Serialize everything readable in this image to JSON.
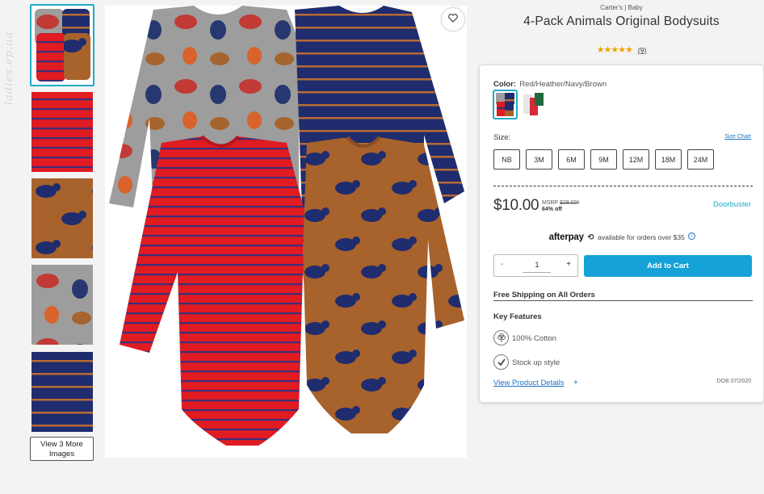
{
  "watermark": "ladies.ep.ua",
  "gallery": {
    "more_images_label_line1": "View 3 More",
    "more_images_label_line2": "Images",
    "thumbnails": [
      "thumb-all-four",
      "thumb-red-stripe",
      "thumb-brown-bears",
      "thumb-heather-animals",
      "thumb-navy-stripe"
    ]
  },
  "favorite": {
    "icon": "heart-icon"
  },
  "product": {
    "brand": "Carter's | Baby",
    "title": "4-Pack Animals Original Bodysuits",
    "stars": "★★★★★",
    "review_count": "(9)"
  },
  "color": {
    "label": "Color:",
    "value": "Red/Heather/Navy/Brown"
  },
  "size": {
    "label": "Size:",
    "chart_link": "Size Chart",
    "options": [
      "NB",
      "3M",
      "6M",
      "9M",
      "12M",
      "18M",
      "24M"
    ]
  },
  "pricing": {
    "price": "$10.00",
    "msrp_label": "MSRP",
    "msrp_value": "$28.00*",
    "percent_off": "64% off",
    "badge": "Doorbuster"
  },
  "afterpay": {
    "logo": "afterpay",
    "text": "available for orders over $35",
    "info": "i"
  },
  "cart": {
    "minus": "-",
    "quantity": "1",
    "plus": "+",
    "add_label": "Add to Cart"
  },
  "shipping": {
    "label": "Free Shipping on All Orders"
  },
  "features": {
    "heading": "Key Features",
    "items": [
      "100% Cotton",
      "Stock up style"
    ]
  },
  "details": {
    "link_label": "View Product Details",
    "plus": "+",
    "dob": "DOB 07/2020"
  },
  "colors": {
    "accent": "#21a9c5",
    "button": "#15a2d7",
    "link": "#1a73c5",
    "star": "#f0a400"
  }
}
